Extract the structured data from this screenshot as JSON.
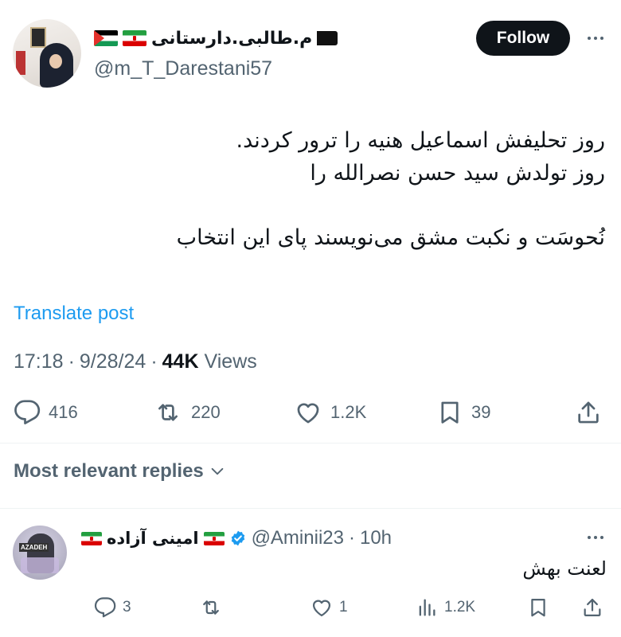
{
  "post": {
    "display_name": "م.طالبی.دارستانی",
    "handle": "@m_T_Darestani57",
    "follow_label": "Follow",
    "text_lines": [
      "روز تحلیفش اسماعیل هنیه را ترور کردند.",
      "روز تولدش سید حسن نصرالله را",
      "نُحوسَت و نکبت مشق می‌نویسند پای این انتخاب"
    ],
    "translate_label": "Translate post",
    "time": "17:18",
    "date": "9/28/24",
    "views_count": "44K",
    "views_label": "Views",
    "separator": "·",
    "stats": {
      "replies": "416",
      "reposts": "220",
      "likes": "1.2K",
      "bookmarks": "39"
    }
  },
  "sort_label": "Most relevant replies",
  "reply": {
    "display_name": "امینی آزاده",
    "handle": "@Aminii23",
    "separator": "·",
    "age": "10h",
    "text": "لعنت بهش",
    "stats": {
      "replies": "3",
      "reposts": "",
      "likes": "1",
      "views": "1.2K"
    }
  },
  "colors": {
    "text_primary": "#0f1419",
    "text_secondary": "#536471",
    "link": "#1d9bf0",
    "verified": "#1d9bf0",
    "follow_bg": "#0f1419"
  },
  "icons": [
    "reply-icon",
    "repost-icon",
    "like-icon",
    "bookmark-icon",
    "share-icon",
    "views-icon",
    "verified-badge-icon",
    "more-icon",
    "chevron-down-icon"
  ]
}
